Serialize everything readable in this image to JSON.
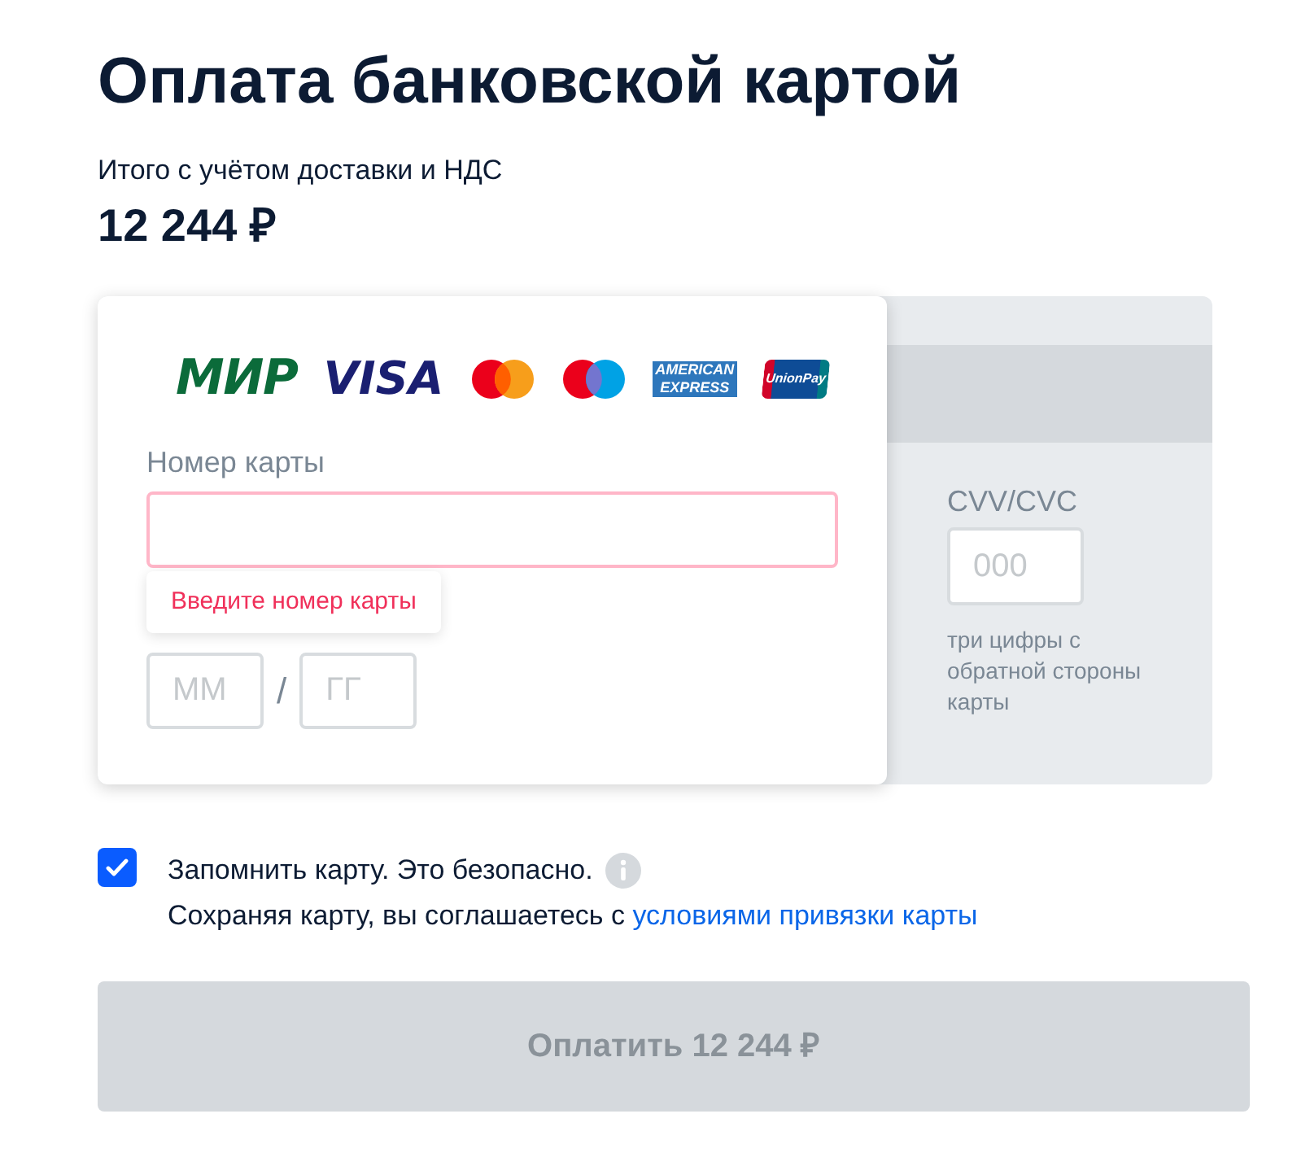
{
  "title": "Оплата банковской картой",
  "total_label": "Итого с учётом доставки и НДС",
  "total": "12 244 ₽",
  "card_front": {
    "logos": [
      {
        "kind": "mir",
        "text": "МИР"
      },
      {
        "kind": "visa",
        "text": "VISA"
      },
      {
        "kind": "mastercard"
      },
      {
        "kind": "maestro"
      },
      {
        "kind": "amex",
        "lines": [
          "AMERICAN",
          "EXPRESS"
        ]
      },
      {
        "kind": "unionpay",
        "text": "UnionPay"
      }
    ],
    "number_label": "Номер карты",
    "number_error": true,
    "error_tooltip": "Введите номер карты",
    "month_placeholder": "ММ",
    "separator": "/",
    "year_placeholder": "ГГ"
  },
  "card_back": {
    "cvv_label": "CVV/CVC",
    "cvv_placeholder": "000",
    "cvv_hint": "три цифры с обратной стороны карты"
  },
  "remember": {
    "checked": true,
    "label": "Запомнить карту. Это безопасно.",
    "note": "Сохраняя карту, вы соглашаетесь с",
    "link": "условиями привязки карты"
  },
  "pay_button": {
    "label": "Оплатить 12 244 ₽",
    "disabled": true
  }
}
